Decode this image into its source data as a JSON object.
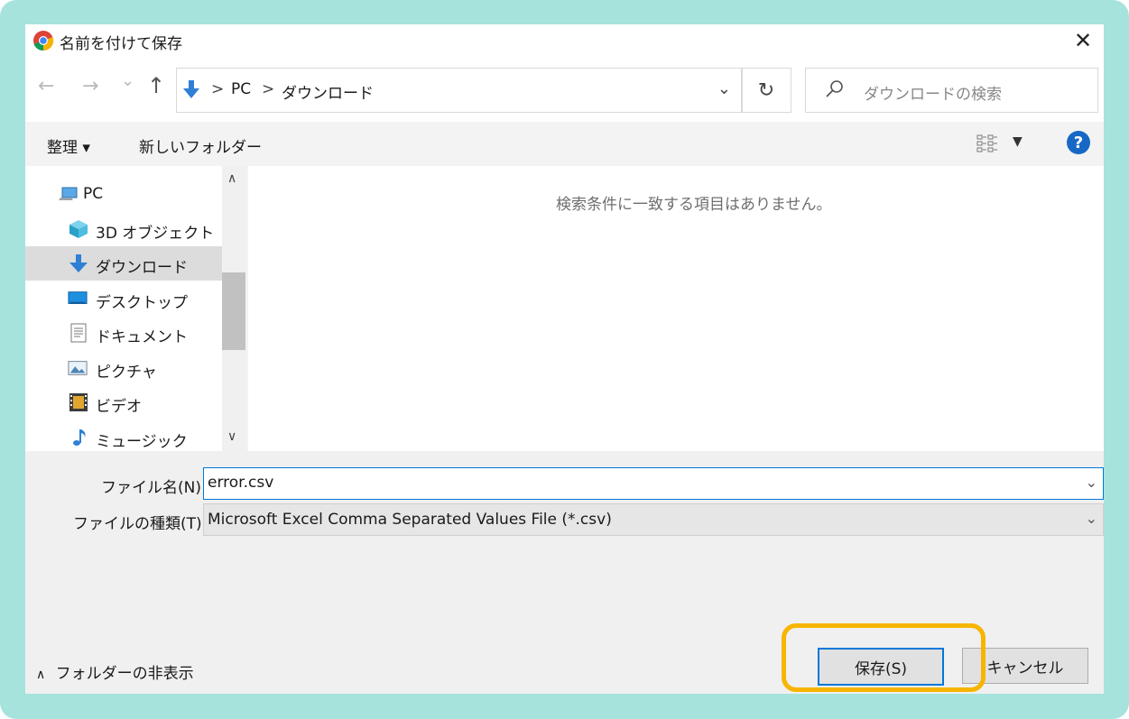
{
  "window": {
    "title": "名前を付けて保存",
    "close_glyph": "✕"
  },
  "nav": {
    "back_glyph": "←",
    "forward_glyph": "→",
    "recent_glyph": "⌄",
    "up_glyph": "↑",
    "breadcrumbs": [
      "PC",
      "ダウンロード"
    ],
    "breadcrumb_sep": ">",
    "address_dropdown_glyph": "⌄",
    "refresh_glyph": "↻",
    "search_placeholder": "ダウンロードの検索"
  },
  "toolbar": {
    "organize_label": "整理 ▾",
    "new_folder_label": "新しいフォルダー",
    "view_dropdown_glyph": "▼",
    "help_label": "?"
  },
  "tree": {
    "items": [
      {
        "label": "PC",
        "icon": "pc-icon"
      },
      {
        "label": "3D オブジェクト",
        "icon": "3d-objects-icon"
      },
      {
        "label": "ダウンロード",
        "icon": "download-icon",
        "selected": true
      },
      {
        "label": "デスクトップ",
        "icon": "desktop-icon"
      },
      {
        "label": "ドキュメント",
        "icon": "document-icon"
      },
      {
        "label": "ピクチャ",
        "icon": "picture-icon"
      },
      {
        "label": "ビデオ",
        "icon": "video-icon"
      },
      {
        "label": "ミュージック",
        "icon": "music-icon"
      }
    ],
    "scroll_up_glyph": "∧",
    "scroll_down_glyph": "∨"
  },
  "content": {
    "empty_message": "検索条件に一致する項目はありません。"
  },
  "form": {
    "filename_label": "ファイル名(N):",
    "filename_value": "error.csv",
    "filetype_label": "ファイルの種類(T):",
    "filetype_value": "Microsoft Excel Comma Separated Values File (*.csv)",
    "dropdown_glyph": "⌄"
  },
  "footer": {
    "hide_folders_chevron": "∧",
    "hide_folders_label": "フォルダーの非表示",
    "save_label": "保存(S)",
    "cancel_label": "キャンセル"
  },
  "colors": {
    "frame": "#a6e3dd",
    "highlight": "#f7b500",
    "accent": "#0078d7"
  }
}
